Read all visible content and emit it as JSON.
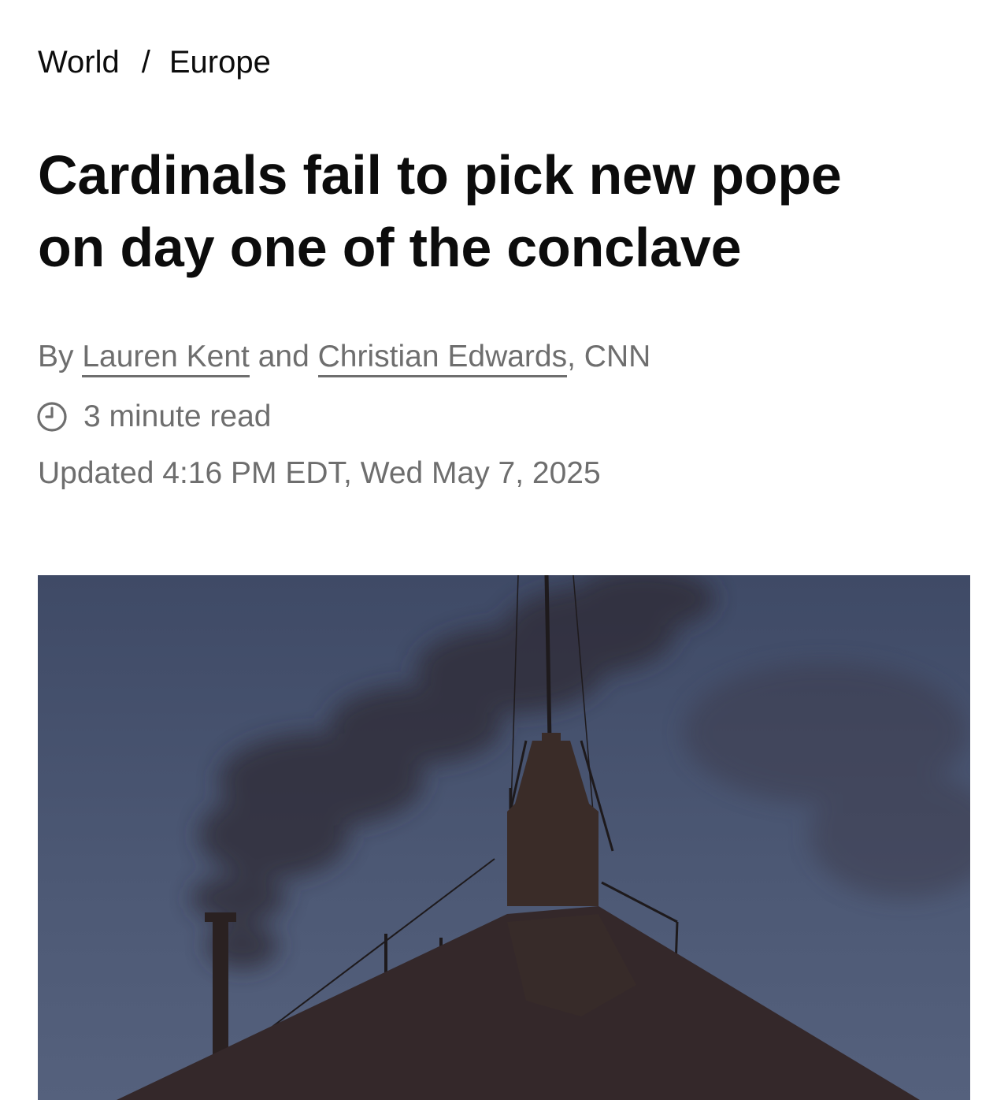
{
  "breadcrumb": {
    "section": "World",
    "separator": "/",
    "subsection": "Europe"
  },
  "article": {
    "headline_line1": "Cardinals fail to pick new pope",
    "headline_line2": "on day one of the conclave",
    "byline_prefix": "By",
    "author1": "Lauren Kent",
    "byline_and": "and",
    "author2": "Christian Edwards",
    "byline_suffix": ", CNN",
    "read_time": "3 minute read",
    "updated": "Updated 4:16 PM EDT, Wed May 7, 2025"
  },
  "icons": {
    "read_time_icon": "clock-icon"
  },
  "colors": {
    "text_primary": "#0c0c0c",
    "text_secondary": "#6e6e6e",
    "sky": "#4a5672",
    "roof": "#2e2320"
  }
}
